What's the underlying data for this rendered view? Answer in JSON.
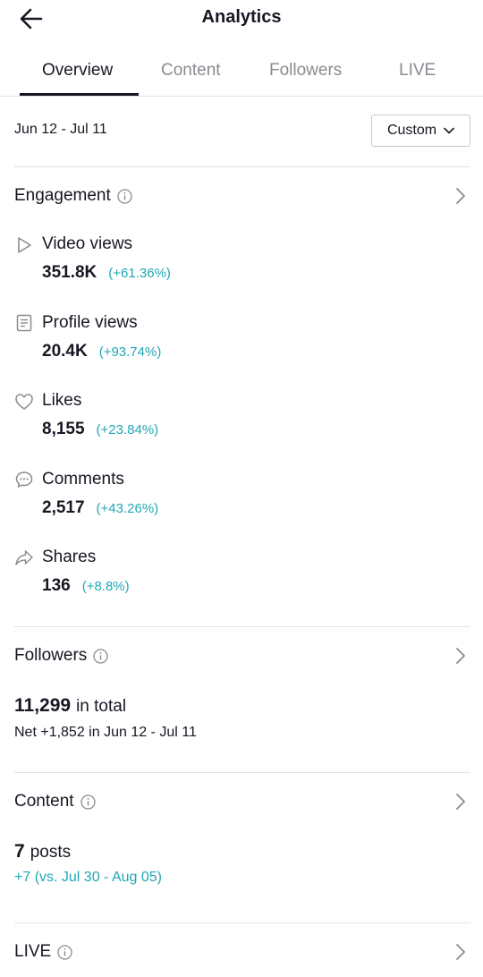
{
  "header": {
    "title": "Analytics"
  },
  "tabs": [
    {
      "label": "Overview",
      "active": true
    },
    {
      "label": "Content",
      "active": false
    },
    {
      "label": "Followers",
      "active": false
    },
    {
      "label": "LIVE",
      "active": false
    }
  ],
  "filter": {
    "date_range": "Jun 12 - Jul 11",
    "custom_label": "Custom"
  },
  "engagement": {
    "title": "Engagement",
    "metrics": [
      {
        "icon": "play-icon",
        "label": "Video views",
        "value": "351.8K",
        "change": "(+61.36%)"
      },
      {
        "icon": "profile-doc-icon",
        "label": "Profile views",
        "value": "20.4K",
        "change": "(+93.74%)"
      },
      {
        "icon": "heart-icon",
        "label": "Likes",
        "value": "8,155",
        "change": "(+23.84%)"
      },
      {
        "icon": "comment-icon",
        "label": "Comments",
        "value": "2,517",
        "change": "(+43.26%)"
      },
      {
        "icon": "share-icon",
        "label": "Shares",
        "value": "136",
        "change": "(+8.8%)"
      }
    ]
  },
  "followers": {
    "title": "Followers",
    "total": "11,299",
    "total_suffix": "in total",
    "net": "Net +1,852 in Jun 12 - Jul 11"
  },
  "content": {
    "title": "Content",
    "count": "7",
    "count_suffix": "posts",
    "comparison": "+7 (vs. Jul 30 - Aug 05)"
  },
  "live": {
    "title": "LIVE"
  },
  "colors": {
    "accent_teal": "#20a8b5",
    "text": "#161823",
    "muted": "#8a8b91"
  }
}
